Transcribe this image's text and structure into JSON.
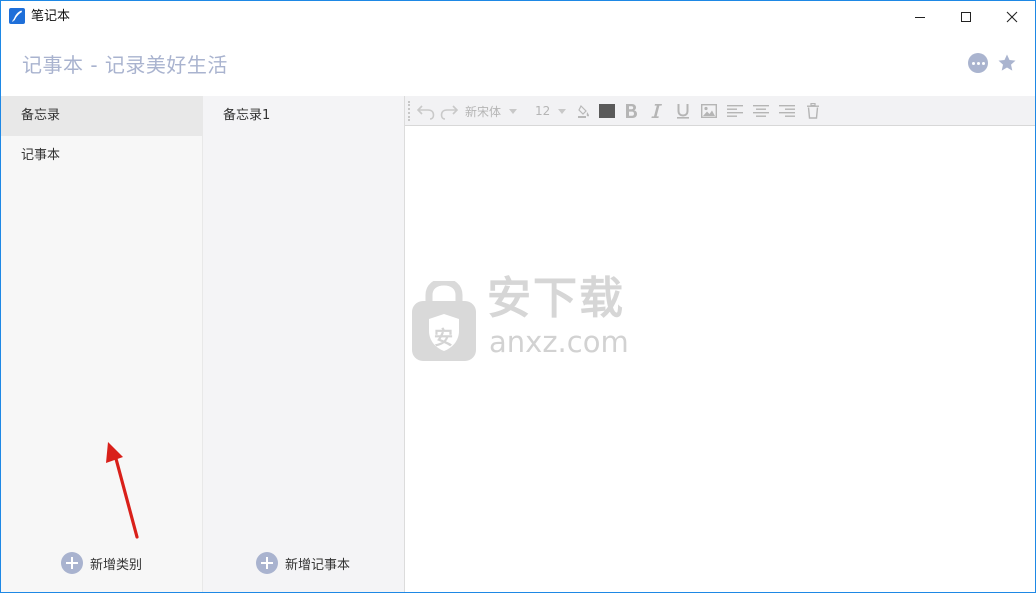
{
  "window": {
    "title": "笔记本"
  },
  "header": {
    "title": "记事本 - 记录美好生活"
  },
  "categories": {
    "items": [
      {
        "label": "备忘录",
        "active": true
      },
      {
        "label": "记事本",
        "active": false
      }
    ],
    "add_label": "新增类别"
  },
  "notes": {
    "items": [
      {
        "label": "备忘录1"
      }
    ],
    "add_label": "新增记事本"
  },
  "toolbar": {
    "font_family": "新宋体",
    "font_size": "12"
  },
  "watermark": {
    "text_cn": "安下载",
    "text_en": "anxz.com",
    "badge": "安"
  },
  "colors": {
    "accent": "#a9b3cf",
    "window_border": "#1e88e5",
    "annotation_arrow": "#d9201a"
  }
}
